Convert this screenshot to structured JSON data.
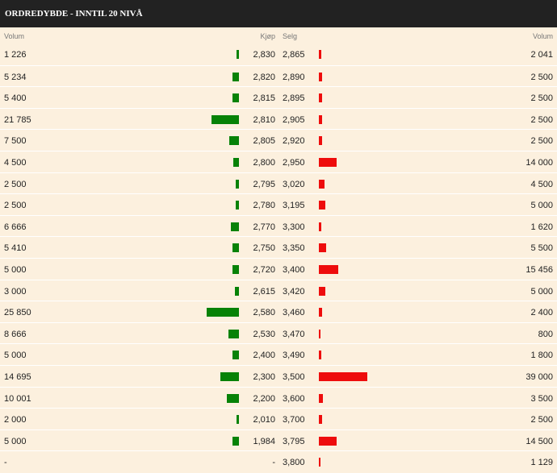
{
  "header": {
    "title": "ORDREDYBDE - INNTIL 20 NIVÅ"
  },
  "columns": {
    "volume_left": "Volum",
    "bid": "Kjøp",
    "ask": "Selg",
    "volume_right": "Volum"
  },
  "colors": {
    "bid_bar": "#078207",
    "ask_bar": "#ee0c0c",
    "header_bg": "#222222",
    "background": "#fcf0de"
  },
  "chart_data": {
    "type": "bar",
    "series": [
      {
        "name": "Kjøp",
        "values": [
          1226,
          5234,
          5400,
          21785,
          7500,
          4500,
          2500,
          2500,
          6666,
          5410,
          5000,
          3000,
          25850,
          8666,
          5000,
          14695,
          10001,
          2000,
          5000,
          null
        ]
      },
      {
        "name": "Selg",
        "values": [
          2041,
          2500,
          2500,
          2500,
          2500,
          14000,
          4500,
          5000,
          1620,
          5500,
          15456,
          5000,
          2400,
          800,
          1800,
          39000,
          3500,
          2500,
          14500,
          1129
        ]
      }
    ]
  },
  "rows": [
    {
      "bid_vol": "1 226",
      "bid": "2,830",
      "ask": "2,865",
      "ask_vol": "2 041"
    },
    {
      "bid_vol": "5 234",
      "bid": "2,820",
      "ask": "2,890",
      "ask_vol": "2 500"
    },
    {
      "bid_vol": "5 400",
      "bid": "2,815",
      "ask": "2,895",
      "ask_vol": "2 500"
    },
    {
      "bid_vol": "21 785",
      "bid": "2,810",
      "ask": "2,905",
      "ask_vol": "2 500"
    },
    {
      "bid_vol": "7 500",
      "bid": "2,805",
      "ask": "2,920",
      "ask_vol": "2 500"
    },
    {
      "bid_vol": "4 500",
      "bid": "2,800",
      "ask": "2,950",
      "ask_vol": "14 000"
    },
    {
      "bid_vol": "2 500",
      "bid": "2,795",
      "ask": "3,020",
      "ask_vol": "4 500"
    },
    {
      "bid_vol": "2 500",
      "bid": "2,780",
      "ask": "3,195",
      "ask_vol": "5 000"
    },
    {
      "bid_vol": "6 666",
      "bid": "2,770",
      "ask": "3,300",
      "ask_vol": "1 620"
    },
    {
      "bid_vol": "5 410",
      "bid": "2,750",
      "ask": "3,350",
      "ask_vol": "5 500"
    },
    {
      "bid_vol": "5 000",
      "bid": "2,720",
      "ask": "3,400",
      "ask_vol": "15 456"
    },
    {
      "bid_vol": "3 000",
      "bid": "2,615",
      "ask": "3,420",
      "ask_vol": "5 000"
    },
    {
      "bid_vol": "25 850",
      "bid": "2,580",
      "ask": "3,460",
      "ask_vol": "2 400"
    },
    {
      "bid_vol": "8 666",
      "bid": "2,530",
      "ask": "3,470",
      "ask_vol": "800"
    },
    {
      "bid_vol": "5 000",
      "bid": "2,400",
      "ask": "3,490",
      "ask_vol": "1 800"
    },
    {
      "bid_vol": "14 695",
      "bid": "2,300",
      "ask": "3,500",
      "ask_vol": "39 000"
    },
    {
      "bid_vol": "10 001",
      "bid": "2,200",
      "ask": "3,600",
      "ask_vol": "3 500"
    },
    {
      "bid_vol": "2 000",
      "bid": "2,010",
      "ask": "3,700",
      "ask_vol": "2 500"
    },
    {
      "bid_vol": "5 000",
      "bid": "1,984",
      "ask": "3,795",
      "ask_vol": "14 500"
    },
    {
      "bid_vol": "-",
      "bid": "-",
      "ask": "3,800",
      "ask_vol": "1 129"
    }
  ]
}
